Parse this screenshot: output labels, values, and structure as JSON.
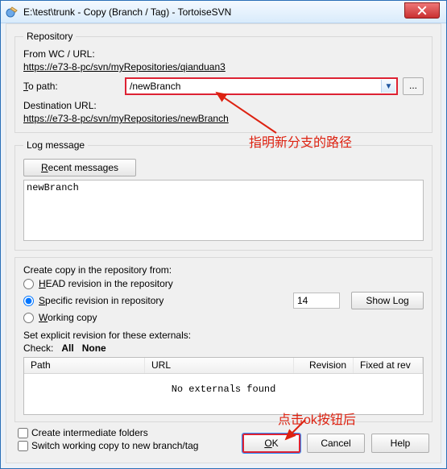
{
  "window": {
    "title": "E:\\test\\trunk - Copy (Branch / Tag) - TortoiseSVN"
  },
  "repository": {
    "legend": "Repository",
    "from_label": "From WC / URL:",
    "from_url": "https://e73-8-pc/svn/myRepositories/qianduan3",
    "to_key": "T",
    "to_rest": "o path:",
    "to_value": "/newBranch",
    "browse_label": "...",
    "dest_label": "Destination URL:",
    "dest_url": "https://e73-8-pc/svn/myRepositories/newBranch"
  },
  "logmsg": {
    "legend": "Log message",
    "recent_key": "R",
    "recent_rest": "ecent messages",
    "message": "newBranch"
  },
  "copyfrom": {
    "intro": "Create copy in the repository from:",
    "head_key": "H",
    "head_rest": "EAD revision in the repository",
    "spec_key": "S",
    "spec_rest": "pecific revision in repository",
    "work_key": "W",
    "work_rest": "orking copy",
    "rev_value": "14",
    "showlog": "Show Log"
  },
  "externals": {
    "intro": "Set explicit revision for these externals:",
    "check_label": "Check:",
    "all": "All",
    "none": "None",
    "col_path": "Path",
    "col_url": "URL",
    "col_rev": "Revision",
    "col_fix": "Fixed at rev",
    "empty": "No externals found"
  },
  "bottom": {
    "create_intermediate": "Create intermediate folders",
    "switch_wc": "Switch working copy to new branch/tag"
  },
  "buttons": {
    "ok_key": "O",
    "ok_rest": "K",
    "cancel": "Cancel",
    "help": "Help"
  },
  "annotations": {
    "a1": "指明新分支的路径",
    "a2": "点击ok按钮后"
  }
}
